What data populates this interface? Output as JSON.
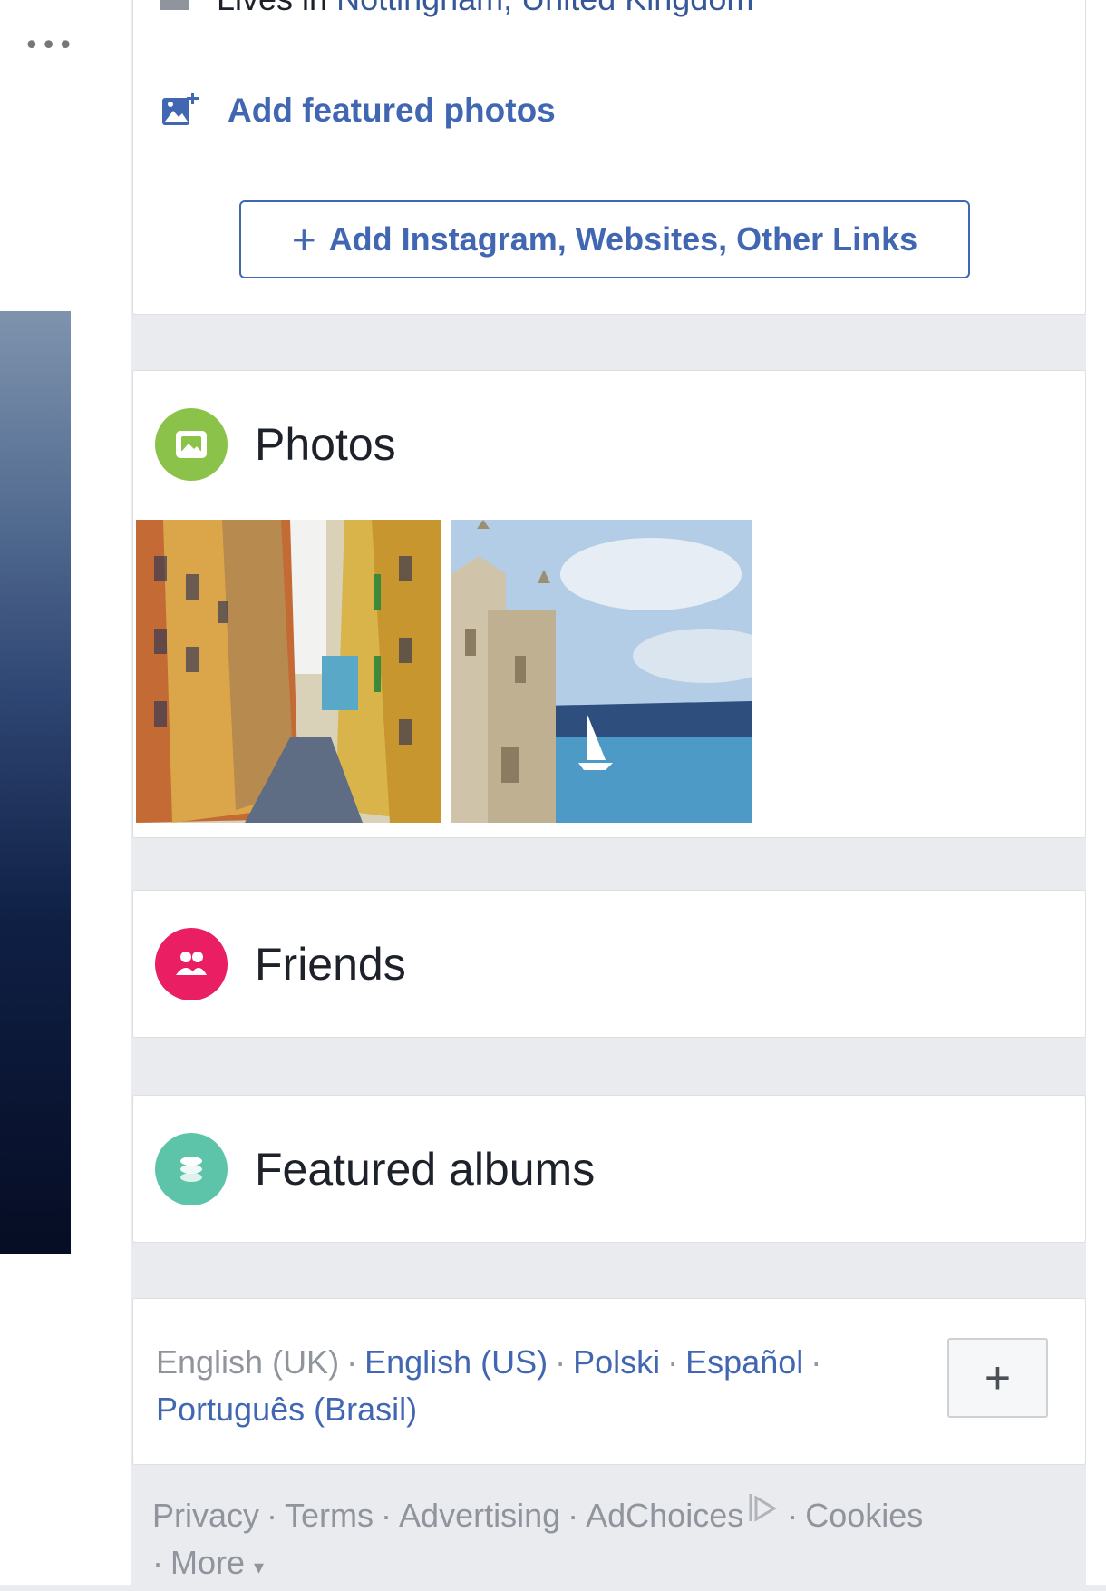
{
  "header": {
    "more_icon": "more-icon",
    "more_glyph": "•••"
  },
  "intro": {
    "lives_in_prefix": "Lives in ",
    "lives_in_place": "Nottingham, United Kingdom",
    "featured_photos_link": "Add featured photos",
    "add_links_button": "Add Instagram, Websites, Other Links",
    "add_links_plus": "+"
  },
  "photos": {
    "title": "Photos",
    "icon": "photo-icon",
    "icon_color": "#8bc34a",
    "items": [
      {
        "icon": "street-photo"
      },
      {
        "icon": "tower-harbor-photo"
      }
    ]
  },
  "friends": {
    "title": "Friends",
    "icon": "friends-icon",
    "icon_color": "#e91e63"
  },
  "albums": {
    "title": "Featured albums",
    "icon": "albums-icon",
    "icon_color": "#5ec4a9"
  },
  "languages": {
    "current": "English (UK)",
    "options": [
      "English (US)",
      "Polski",
      "Español",
      "Português (Brasil)"
    ],
    "sep": "·",
    "add_button": "+"
  },
  "footer": {
    "links": [
      "Privacy",
      "Terms",
      "Advertising",
      "AdChoices",
      "Cookies"
    ],
    "more": "More",
    "more_arrow": "▾",
    "sep": "·"
  },
  "colors": {
    "link_blue": "#4267b2",
    "page_bg": "#e9ebee",
    "card_bg": "#ffffff",
    "muted_text": "#90949c"
  }
}
